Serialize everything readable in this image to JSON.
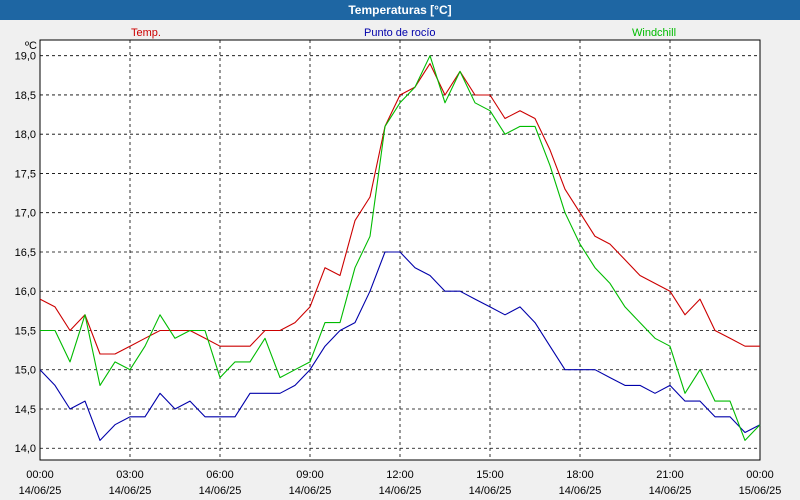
{
  "window": {
    "title": "Temperaturas [°C]"
  },
  "colors": {
    "titlebar": "#1e66a3",
    "plot_bg": "#ffffff",
    "frame_bg": "#f0f0f0"
  },
  "chart_data": {
    "type": "line",
    "title": "Temperaturas [°C]",
    "ylabel": "ºC",
    "ylim": [
      13.85,
      19.2
    ],
    "grid": true,
    "legend_placement": "top",
    "yticks": [
      "14,0",
      "14,5",
      "15,0",
      "15,5",
      "16,0",
      "16,5",
      "17,0",
      "17,5",
      "18,0",
      "18,5",
      "19,0"
    ],
    "ytick_values": [
      14.0,
      14.5,
      15.0,
      15.5,
      16.0,
      16.5,
      17.0,
      17.5,
      18.0,
      18.5,
      19.0
    ],
    "xticks": [
      {
        "time": "00:00",
        "date": "14/06/25"
      },
      {
        "time": "03:00",
        "date": "14/06/25"
      },
      {
        "time": "06:00",
        "date": "14/06/25"
      },
      {
        "time": "09:00",
        "date": "14/06/25"
      },
      {
        "time": "12:00",
        "date": "14/06/25"
      },
      {
        "time": "15:00",
        "date": "14/06/25"
      },
      {
        "time": "18:00",
        "date": "14/06/25"
      },
      {
        "time": "21:00",
        "date": "14/06/25"
      },
      {
        "time": "00:00",
        "date": "15/06/25"
      }
    ],
    "x_hours": [
      0,
      0.5,
      1,
      1.5,
      2,
      2.5,
      3,
      3.5,
      4,
      4.5,
      5,
      5.5,
      6,
      6.5,
      7,
      7.5,
      8,
      8.5,
      9,
      9.5,
      10,
      10.5,
      11,
      11.5,
      12,
      12.5,
      13,
      13.5,
      14,
      14.5,
      15,
      15.5,
      16,
      16.5,
      17,
      17.5,
      18,
      18.5,
      19,
      19.5,
      20,
      20.5,
      21,
      21.5,
      22,
      22.5,
      23,
      23.5,
      24
    ],
    "series": [
      {
        "name": "Temp.",
        "color": "#cc0000",
        "values": [
          15.9,
          15.8,
          15.5,
          15.7,
          15.2,
          15.2,
          15.3,
          15.4,
          15.5,
          15.5,
          15.5,
          15.4,
          15.3,
          15.3,
          15.3,
          15.5,
          15.5,
          15.6,
          15.8,
          16.3,
          16.2,
          16.9,
          17.2,
          18.1,
          18.5,
          18.6,
          18.9,
          18.5,
          18.8,
          18.5,
          18.5,
          18.2,
          18.3,
          18.2,
          17.8,
          17.3,
          17.0,
          16.7,
          16.6,
          16.4,
          16.2,
          16.1,
          16.0,
          15.7,
          15.9,
          15.5,
          15.4,
          15.3,
          15.3
        ]
      },
      {
        "name": "Punto de rocío",
        "color": "#0000aa",
        "values": [
          15.0,
          14.8,
          14.5,
          14.6,
          14.1,
          14.3,
          14.4,
          14.4,
          14.7,
          14.5,
          14.6,
          14.4,
          14.4,
          14.4,
          14.7,
          14.7,
          14.7,
          14.8,
          15.0,
          15.3,
          15.5,
          15.6,
          16.0,
          16.5,
          16.5,
          16.3,
          16.2,
          16.0,
          16.0,
          15.9,
          15.8,
          15.7,
          15.8,
          15.6,
          15.3,
          15.0,
          15.0,
          15.0,
          14.9,
          14.8,
          14.8,
          14.7,
          14.8,
          14.6,
          14.6,
          14.4,
          14.4,
          14.2,
          14.3
        ]
      },
      {
        "name": "Windchill",
        "color": "#00bb00",
        "values": [
          15.5,
          15.5,
          15.1,
          15.7,
          14.8,
          15.1,
          15.0,
          15.3,
          15.7,
          15.4,
          15.5,
          15.5,
          14.9,
          15.1,
          15.1,
          15.4,
          14.9,
          15.0,
          15.1,
          15.6,
          15.6,
          16.3,
          16.7,
          18.1,
          18.4,
          18.6,
          19.0,
          18.4,
          18.8,
          18.4,
          18.3,
          18.0,
          18.1,
          18.1,
          17.6,
          17.0,
          16.6,
          16.3,
          16.1,
          15.8,
          15.6,
          15.4,
          15.3,
          14.7,
          15.0,
          14.6,
          14.6,
          14.1,
          14.3
        ]
      }
    ]
  }
}
